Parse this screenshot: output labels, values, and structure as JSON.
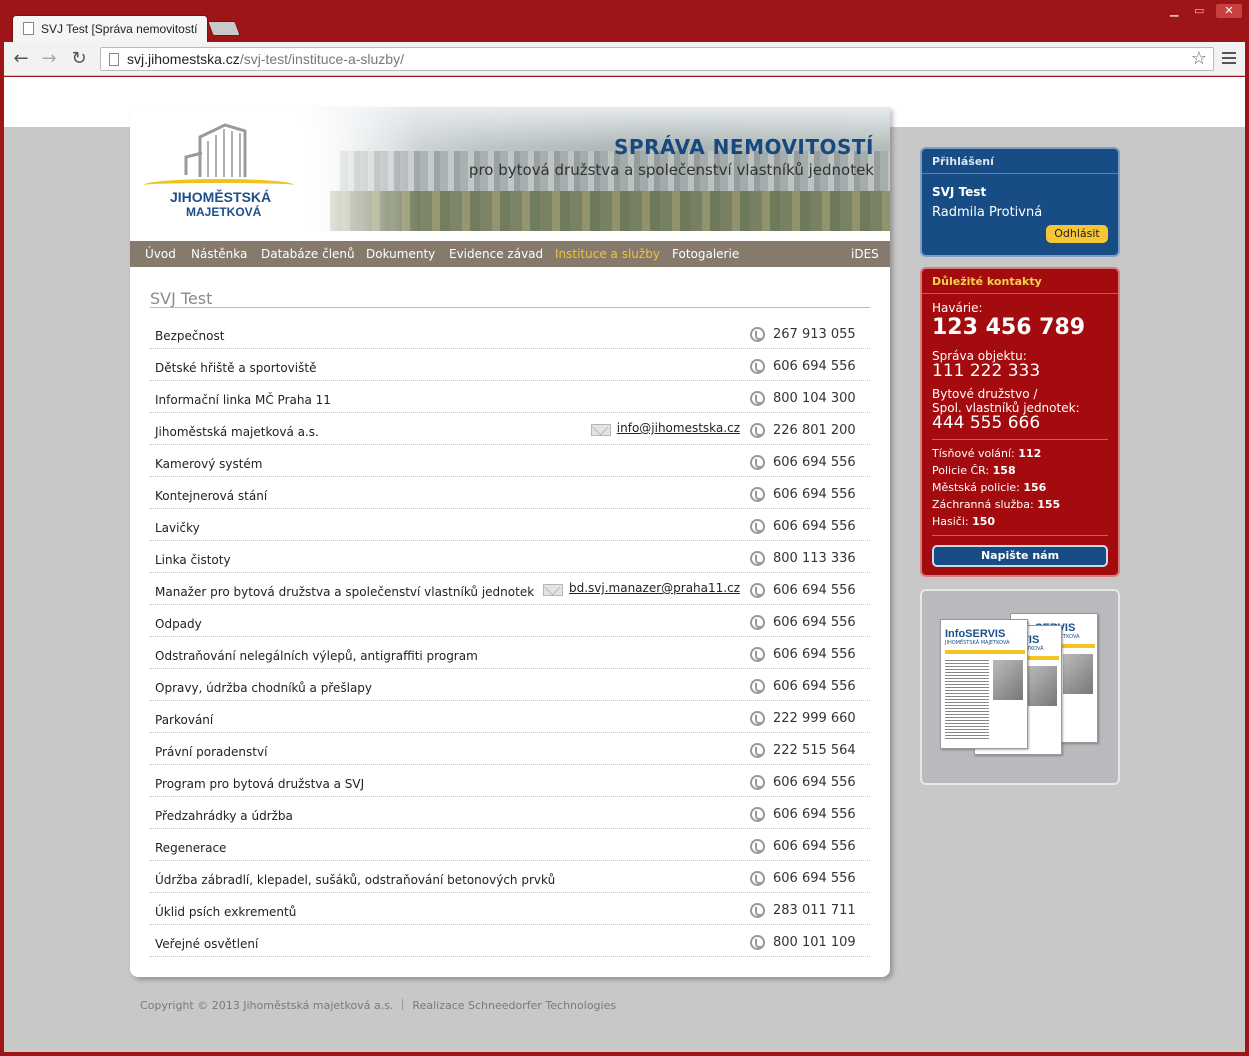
{
  "browser": {
    "tab_title": "SVJ Test [Správa nemovitostí",
    "url_host": "svj.jihomestska.cz",
    "url_path": "/svj-test/instituce-a-sluzby/"
  },
  "header": {
    "logo_line1": "JIHOMĚSTSKÁ",
    "logo_line2": "MAJETKOVÁ",
    "title": "SPRÁVA NEMOVITOSTÍ",
    "subtitle": "pro bytová družstva a společenství vlastníků jednotek"
  },
  "nav": {
    "items": [
      "Úvod",
      "Nástěnka",
      "Databáze členů",
      "Dokumenty",
      "Evidence závad",
      "Instituce a služby",
      "Fotogalerie"
    ],
    "active": "Instituce a služby",
    "right_item": "iDES"
  },
  "main": {
    "title": "SVJ Test",
    "services": [
      {
        "name": "Bezpečnost",
        "phone": "267 913 055"
      },
      {
        "name": "Dětské hřiště a sportoviště",
        "phone": "606 694 556"
      },
      {
        "name": "Informační linka MČ Praha 11",
        "phone": "800 104 300"
      },
      {
        "name": "Jihoměstská majetková a.s.",
        "email": "info@jihomestska.cz",
        "phone": "226 801 200"
      },
      {
        "name": "Kamerový systém",
        "phone": "606 694 556"
      },
      {
        "name": "Kontejnerová stání",
        "phone": "606 694 556"
      },
      {
        "name": "Lavičky",
        "phone": "606 694 556"
      },
      {
        "name": "Linka čistoty",
        "phone": "800 113 336"
      },
      {
        "name": "Manažer pro bytová družstva a společenství vlastníků jednotek",
        "email": "bd.svj.manazer@praha11.cz",
        "phone": "606 694 556"
      },
      {
        "name": "Odpady",
        "phone": "606 694 556"
      },
      {
        "name": "Odstraňování nelegálních výlepů, antigraffiti program",
        "phone": "606 694 556"
      },
      {
        "name": "Opravy, údržba chodníků a přešlapy",
        "phone": "606 694 556"
      },
      {
        "name": "Parkování",
        "phone": "222 999 660"
      },
      {
        "name": "Právní poradenství",
        "phone": "222 515 564"
      },
      {
        "name": "Program pro bytová družstva a SVJ",
        "phone": "606 694 556"
      },
      {
        "name": "Předzahrádky a údržba",
        "phone": "606 694 556"
      },
      {
        "name": "Regenerace",
        "phone": "606 694 556"
      },
      {
        "name": "Údržba zábradlí, klepadel, sušáků, odstraňování betonových prvků",
        "phone": "606 694 556"
      },
      {
        "name": "Úklid psích exkrementů",
        "phone": "283 011 711"
      },
      {
        "name": "Veřejné osvětlení",
        "phone": "800 101 109"
      }
    ]
  },
  "footer": {
    "copyright": "Copyright © 2013 Jihoměstská majetková a.s.",
    "credit": "Realizace Schneedorfer Technologies"
  },
  "login": {
    "heading": "Přihlášení",
    "user_org": "SVJ Test",
    "user_name": "Radmila Protivná",
    "logout_label": "Odhlásit"
  },
  "contacts": {
    "heading": "Důležité kontakty",
    "emergency_label": "Havárie:",
    "emergency_phone": "123 456 789",
    "object_label": "Správa objektu:",
    "object_phone": "111 222 333",
    "coop_label_1": "Bytové družstvo /",
    "coop_label_2": "Spol. vlastníků jednotek:",
    "coop_phone": "444 555 666",
    "lines": [
      {
        "label": "Tísňové volání:",
        "value": "112"
      },
      {
        "label": "Policie ČR:",
        "value": "158"
      },
      {
        "label": "Městská policie:",
        "value": "156"
      },
      {
        "label": "Záchranná služba:",
        "value": "155"
      },
      {
        "label": "Hasiči:",
        "value": "150"
      }
    ],
    "write_label": "Napište nám"
  },
  "infoservis": {
    "title": "InfoSERVIS",
    "subtitle": "JIHOMĚSTSKÁ MAJETKOVÁ"
  },
  "colors": {
    "nav_bg": "#857a6c",
    "nav_active": "#f4c431",
    "login_bg": "#174d84",
    "contacts_bg": "#a40b0e",
    "title_blue": "#17487f"
  }
}
